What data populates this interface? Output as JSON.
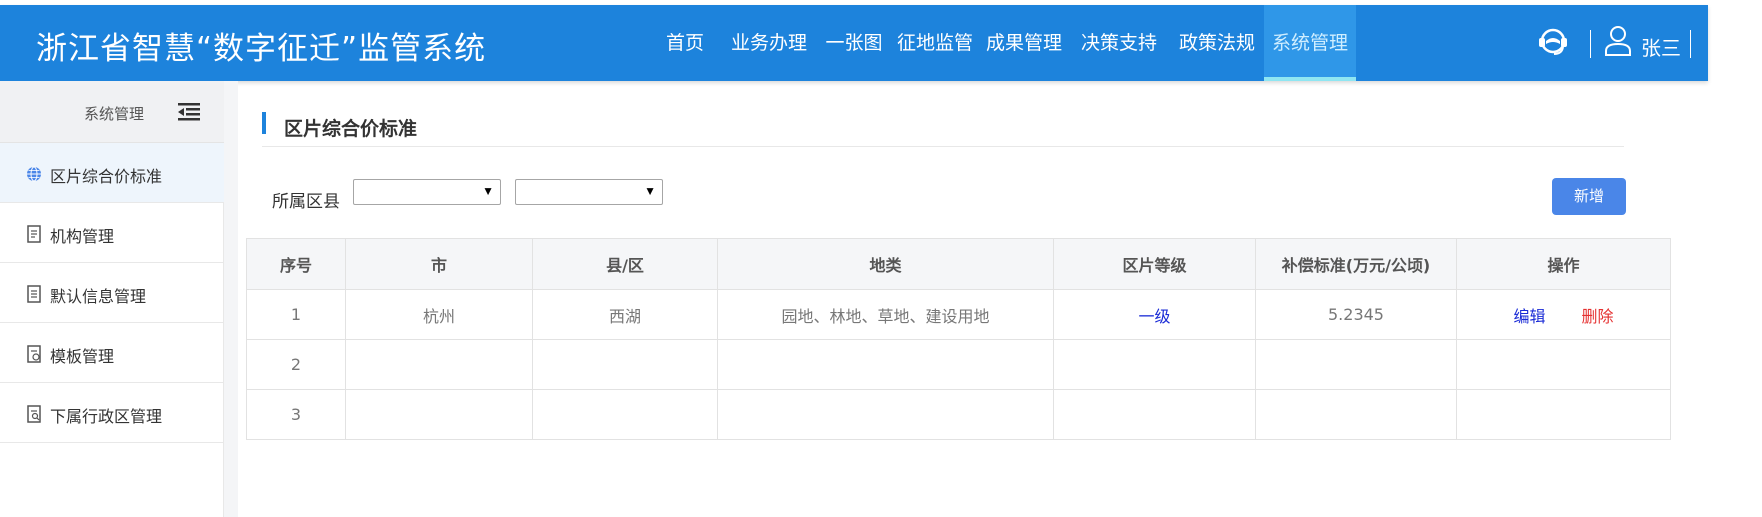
{
  "header": {
    "title": "浙江省智慧“数字征迁”监管系统",
    "nav": [
      "首页",
      "业务办理",
      "一张图",
      "征地监管",
      "成果管理",
      "决策支持",
      "政策法规",
      "系统管理"
    ],
    "active_nav": "系统管理",
    "user_name": "张三"
  },
  "sidebar": {
    "heading": "系统管理",
    "items": [
      {
        "label": "区片综合价标准",
        "icon": "globe-icon"
      },
      {
        "label": "机构管理",
        "icon": "document-icon"
      },
      {
        "label": "默认信息管理",
        "icon": "document-icon"
      },
      {
        "label": "模板管理",
        "icon": "document-gear-icon"
      },
      {
        "label": "下属行政区管理",
        "icon": "document-search-icon"
      }
    ]
  },
  "main": {
    "title": "区片综合价标准",
    "filter_label": "所属区县",
    "add_button": "新增",
    "table": {
      "headers": [
        "序号",
        "市",
        "县/区",
        "地类",
        "区片等级",
        "补偿标准(万元/公顷)",
        "操作"
      ],
      "rows": [
        {
          "index": "1",
          "city": "杭州",
          "district": "西湖",
          "land_type": "园地、林地、草地、建设用地",
          "level": "一级",
          "standard": "5.2345",
          "edit": "编辑",
          "delete": "删除"
        },
        {
          "index": "2",
          "city": "",
          "district": "",
          "land_type": "",
          "level": "",
          "standard": "",
          "edit": "",
          "delete": ""
        },
        {
          "index": "3",
          "city": "",
          "district": "",
          "land_type": "",
          "level": "",
          "standard": "",
          "edit": "",
          "delete": ""
        }
      ]
    }
  },
  "colors": {
    "header_bg": "#1d83dc",
    "active_nav_bg": "#2f97e8",
    "active_nav_underline": "#8fe6f2",
    "button_bg": "#4a86e8",
    "link_blue": "#1a2bd6",
    "delete_red": "#e53030"
  }
}
